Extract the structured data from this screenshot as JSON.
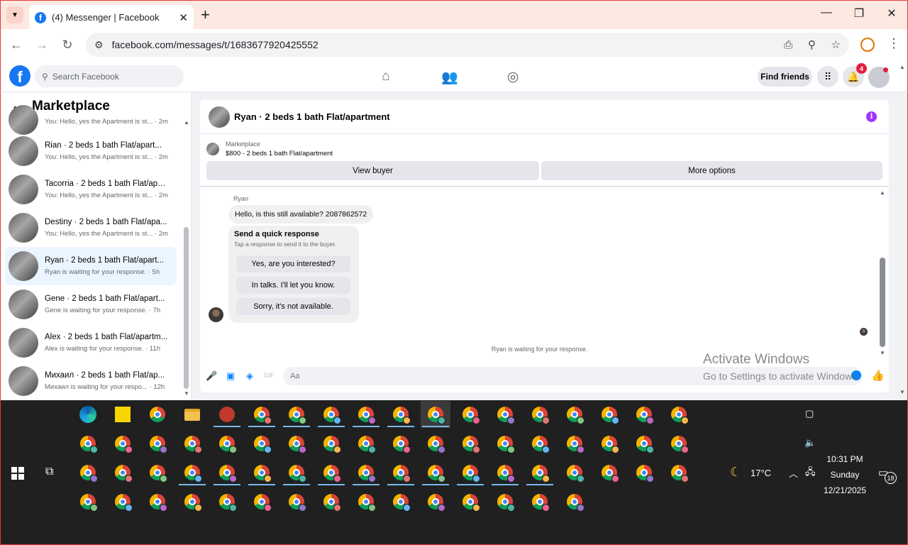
{
  "browser": {
    "tab_title": "(4) Messenger | Facebook",
    "tab_close": "✕",
    "new_tab": "+",
    "url": "facebook.com/messages/t/1683677920425552",
    "window_controls": [
      "—",
      "❐",
      "✕"
    ]
  },
  "fb_header": {
    "search_placeholder": "Search Facebook",
    "find_friends": "Find friends",
    "notification_count": "4"
  },
  "left_panel": {
    "title": "Marketplace",
    "conversations": [
      {
        "name": "",
        "preview": "You: Hello, yes the Apartment is st... · 2m",
        "active": false
      },
      {
        "name": "Rian · 2 beds 1 bath Flat/apart...",
        "preview": "You: Hello, yes the Apartment is st... · 2m",
        "active": false
      },
      {
        "name": "Tacorria · 2 beds 1 bath Flat/apa...",
        "preview": "You: Hello, yes the Apartment is st... · 2m",
        "active": false
      },
      {
        "name": "Destiny · 2 beds 1 bath Flat/apa...",
        "preview": "You: Hello, yes the Apartment is st... · 2m",
        "active": false
      },
      {
        "name": "Ryan · 2 beds 1 bath Flat/apart...",
        "preview": "Ryan is waiting for your response. · 5h",
        "active": true
      },
      {
        "name": "Gene · 2 beds 1 bath Flat/apart...",
        "preview": "Gene is waiting for your response. · 7h",
        "active": false
      },
      {
        "name": "Alex · 2 beds 1 bath Flat/apartm...",
        "preview": "Alex is waiting for your response. · 11h",
        "active": false
      },
      {
        "name": "Михаил · 2 beds 1 bath Flat/ap...",
        "preview": "Михаил is waiting for your respo... · 12h",
        "active": false
      }
    ]
  },
  "chat": {
    "title": "Ryan · 2 beds 1 bath Flat/apartment",
    "marketplace_label": "Marketplace",
    "listing": "$800 - 2 beds 1 bath Flat/apartment",
    "view_buyer": "View buyer",
    "more_options": "More options",
    "sender": "Ryan",
    "message": "Hello, is this still available? 2087862572",
    "quick_title": "Send a quick response",
    "quick_sub": "Tap a response to send it to the buyer.",
    "quick_responses": [
      "Yes, are you interested?",
      "In talks. I'll let you know.",
      "Sorry, it's not available."
    ],
    "status": "Ryan is waiting for your response.",
    "input_placeholder": "Aa"
  },
  "watermark": {
    "line1": "Activate Windows",
    "line2": "Go to Settings to activate Windows."
  },
  "taskbar": {
    "weather": "17°C",
    "time": "10:31 PM",
    "day": "Sunday",
    "date": "12/21/2025",
    "notification_count": "18",
    "profile_colors": [
      "#e57373",
      "#81c784",
      "#64b5f6",
      "#ba68c8",
      "#ffb74d",
      "#4db6ac",
      "#f06292",
      "#9575cd"
    ]
  }
}
